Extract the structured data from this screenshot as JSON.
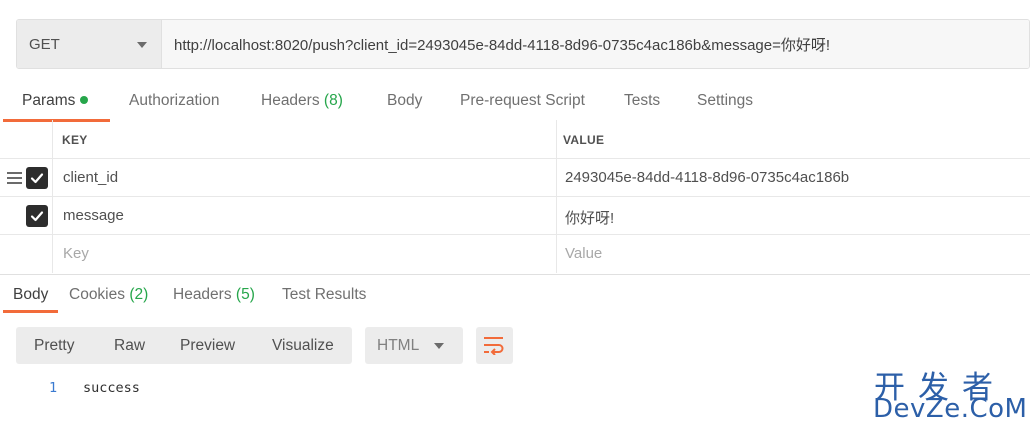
{
  "request": {
    "method": "GET",
    "url": "http://localhost:8020/push?client_id=2493045e-84dd-4118-8d96-0735c4ac186b&message=你好呀!"
  },
  "request_tabs": [
    {
      "label": "Params",
      "active": true
    },
    {
      "label": "Authorization"
    },
    {
      "label": "Headers",
      "count": "(8)"
    },
    {
      "label": "Body"
    },
    {
      "label": "Pre-request Script"
    },
    {
      "label": "Tests"
    },
    {
      "label": "Settings"
    }
  ],
  "params": {
    "headers": {
      "key": "KEY",
      "value": "VALUE"
    },
    "rows": [
      {
        "key": "client_id",
        "value": "2493045e-84dd-4118-8d96-0735c4ac186b",
        "checked": true
      },
      {
        "key": "message",
        "value": "你好呀!",
        "checked": true
      }
    ],
    "placeholder": {
      "key": "Key",
      "value": "Value"
    }
  },
  "response_tabs": [
    {
      "label": "Body",
      "active": true
    },
    {
      "label": "Cookies",
      "count": "(2)"
    },
    {
      "label": "Headers",
      "count": "(5)"
    },
    {
      "label": "Test Results"
    }
  ],
  "response_toolbar": {
    "views": [
      "Pretty",
      "Raw",
      "Preview",
      "Visualize"
    ],
    "format": "HTML"
  },
  "response_body": {
    "lines": [
      {
        "number": "1",
        "text": "success"
      }
    ]
  },
  "watermark": {
    "top": "开发者",
    "bottom": "DevZe.CoM"
  },
  "colors": {
    "accent": "#f26b3a",
    "count_green": "#26a64b",
    "watermark_blue": "#2c5fa8",
    "line_number_blue": "#3a7ad0"
  },
  "icons": {
    "method_dropdown": "chevron-down-icon",
    "drag_handle": "drag-handle-icon",
    "checkbox": "check-icon",
    "format_dropdown": "chevron-down-icon",
    "wrap": "wrap-lines-icon"
  }
}
